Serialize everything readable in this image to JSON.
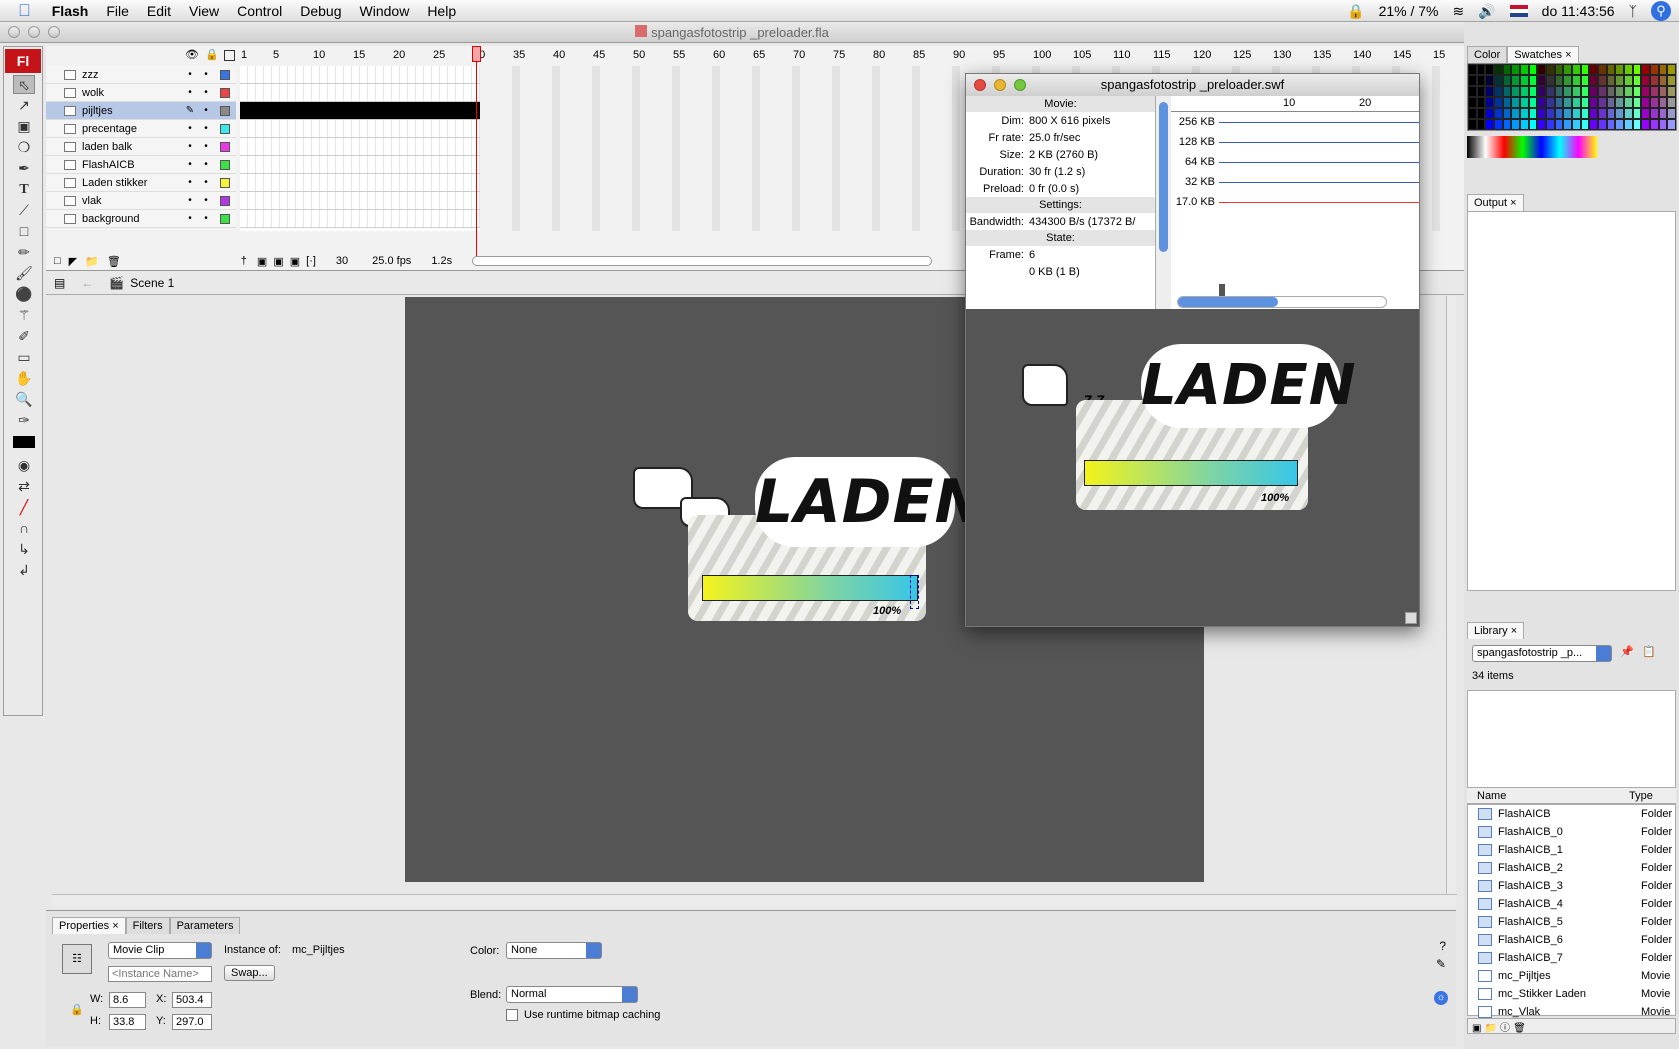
{
  "menubar": {
    "app": "Flash",
    "items": [
      "File",
      "Edit",
      "View",
      "Control",
      "Debug",
      "Window",
      "Help"
    ],
    "battery": "21% / 7%",
    "clock": "do 11:43:56"
  },
  "window": {
    "title": "spangasfotostrip _preloader.fla"
  },
  "tools": {
    "logo": "Fl"
  },
  "timeline": {
    "ruler_numbers": [
      "1",
      "5",
      "10",
      "15",
      "20",
      "25",
      "30",
      "35",
      "40",
      "45",
      "50",
      "55",
      "60",
      "65",
      "70",
      "75",
      "80",
      "85",
      "90",
      "95",
      "100",
      "105",
      "110",
      "115",
      "120",
      "125",
      "130",
      "135",
      "140",
      "145",
      "15"
    ],
    "layers": [
      {
        "name": "zzz",
        "color": "#3a74e0"
      },
      {
        "name": "wolk",
        "color": "#e84545"
      },
      {
        "name": "pijltjes",
        "color": "#8a8a8a"
      },
      {
        "name": "precentage",
        "color": "#3de8ea"
      },
      {
        "name": "laden balk",
        "color": "#e83ce0"
      },
      {
        "name": "FlashAICB",
        "color": "#3ee04a"
      },
      {
        "name": "Laden stikker",
        "color": "#f4f23a"
      },
      {
        "name": "vlak",
        "color": "#b03ae0"
      },
      {
        "name": "background",
        "color": "#3ee04a"
      }
    ],
    "footer": {
      "frame": "30",
      "fps": "25.0 fps",
      "time": "1.2s"
    }
  },
  "scene": {
    "label": "Scene 1"
  },
  "artwork": {
    "laden": "LADEN",
    "zz": "Z Z",
    "percent": "100%"
  },
  "swf_window": {
    "title": "spangasfotostrip _preloader.swf",
    "movie_head": "Movie:",
    "movie": [
      {
        "k": "Dim:",
        "v": "800 X 616 pixels"
      },
      {
        "k": "Fr rate:",
        "v": "25.0 fr/sec"
      },
      {
        "k": "Size:",
        "v": "2 KB (2760 B)"
      },
      {
        "k": "Duration:",
        "v": "30 fr (1.2 s)"
      },
      {
        "k": "Preload:",
        "v": "0 fr (0.0 s)"
      }
    ],
    "settings_head": "Settings:",
    "bandwidth_k": "Bandwidth:",
    "bandwidth_v": "434300 B/s (17372 B/",
    "state_head": "State:",
    "frame_k": "Frame:",
    "frame_v": "6",
    "frame_size": "0 KB (1 B)",
    "graph_ticks": [
      "10",
      "20"
    ],
    "graph_rows": [
      "256 KB",
      "128 KB",
      "64 KB",
      "32 KB",
      "17.0 KB"
    ]
  },
  "right_panel": {
    "color_tab": "Color",
    "swatches_tab": "Swatches",
    "output_tab": "Output",
    "library_tab": "Library",
    "library_select": "spangasfotostrip _p...",
    "library_count": "34 items",
    "col_name": "Name",
    "col_type": "Type",
    "library_items": [
      {
        "name": "FlashAICB",
        "type": "Folder"
      },
      {
        "name": "FlashAICB_0",
        "type": "Folder"
      },
      {
        "name": "FlashAICB_1",
        "type": "Folder"
      },
      {
        "name": "FlashAICB_2",
        "type": "Folder"
      },
      {
        "name": "FlashAICB_3",
        "type": "Folder"
      },
      {
        "name": "FlashAICB_4",
        "type": "Folder"
      },
      {
        "name": "FlashAICB_5",
        "type": "Folder"
      },
      {
        "name": "FlashAICB_6",
        "type": "Folder"
      },
      {
        "name": "FlashAICB_7",
        "type": "Folder"
      },
      {
        "name": "mc_Pijltjes",
        "type": "Movie"
      },
      {
        "name": "mc_Stikker Laden",
        "type": "Movie"
      },
      {
        "name": "mc_Vlak",
        "type": "Movie"
      }
    ]
  },
  "properties": {
    "tabs": [
      "Properties",
      "Filters",
      "Parameters"
    ],
    "symbol_type": "Movie Clip",
    "instance_of_label": "Instance of:",
    "instance_of": "mc_Pijltjes",
    "instance_name_placeholder": "<Instance Name>",
    "swap": "Swap...",
    "w_label": "W:",
    "w": "8.6",
    "x_label": "X:",
    "x": "503.4",
    "h_label": "H:",
    "h": "33.8",
    "y_label": "Y:",
    "y": "297.0",
    "color_label": "Color:",
    "color": "None",
    "blend_label": "Blend:",
    "blend": "Normal",
    "cache_label": "Use runtime bitmap caching"
  }
}
